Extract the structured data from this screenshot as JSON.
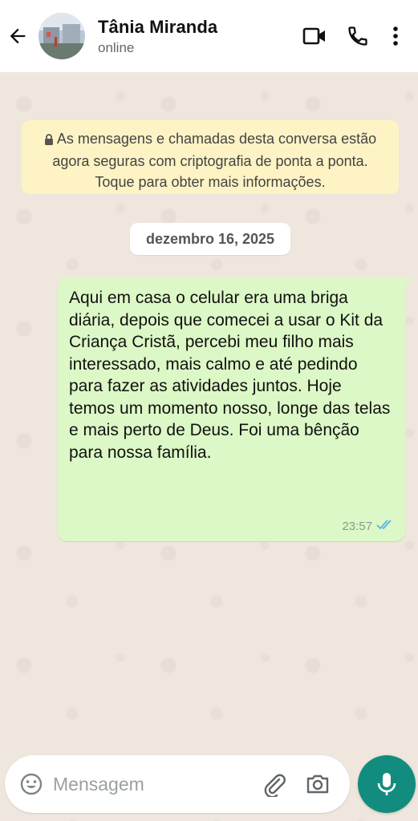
{
  "header": {
    "contact_name": "Tânia Miranda",
    "status": "online",
    "icons": [
      "back-arrow-icon",
      "video-call-icon",
      "phone-call-icon",
      "more-options-icon"
    ]
  },
  "chat": {
    "encryption_notice": "As mensagens e chamadas desta conversa estão agora seguras com criptografia de ponta a ponta. Toque para obter mais informações.",
    "date_chip": "dezembro 16, 2025",
    "messages": [
      {
        "direction": "outgoing",
        "text": "Aqui em casa o celular era uma briga diária, depois que comecei a usar o Kit da Criança Cristã, percebi meu filho mais interessado, mais calmo e até pedindo para fazer as atividades juntos. Hoje temos um momento nosso, longe das telas e mais perto de Deus. Foi uma bênção para nossa família.",
        "time": "23:57",
        "read": true
      }
    ]
  },
  "composer": {
    "placeholder": "Mensagem",
    "icons": [
      "emoji-icon",
      "attach-icon",
      "camera-icon",
      "mic-icon"
    ]
  },
  "colors": {
    "header_bg": "#ffffff",
    "chat_bg": "#efe7dd",
    "outgoing_bubble": "#dcf8c6",
    "encryption_notice_bg": "#fdf3c5",
    "mic_button": "#128c7e",
    "read_ticks": "#4fb6ec"
  }
}
